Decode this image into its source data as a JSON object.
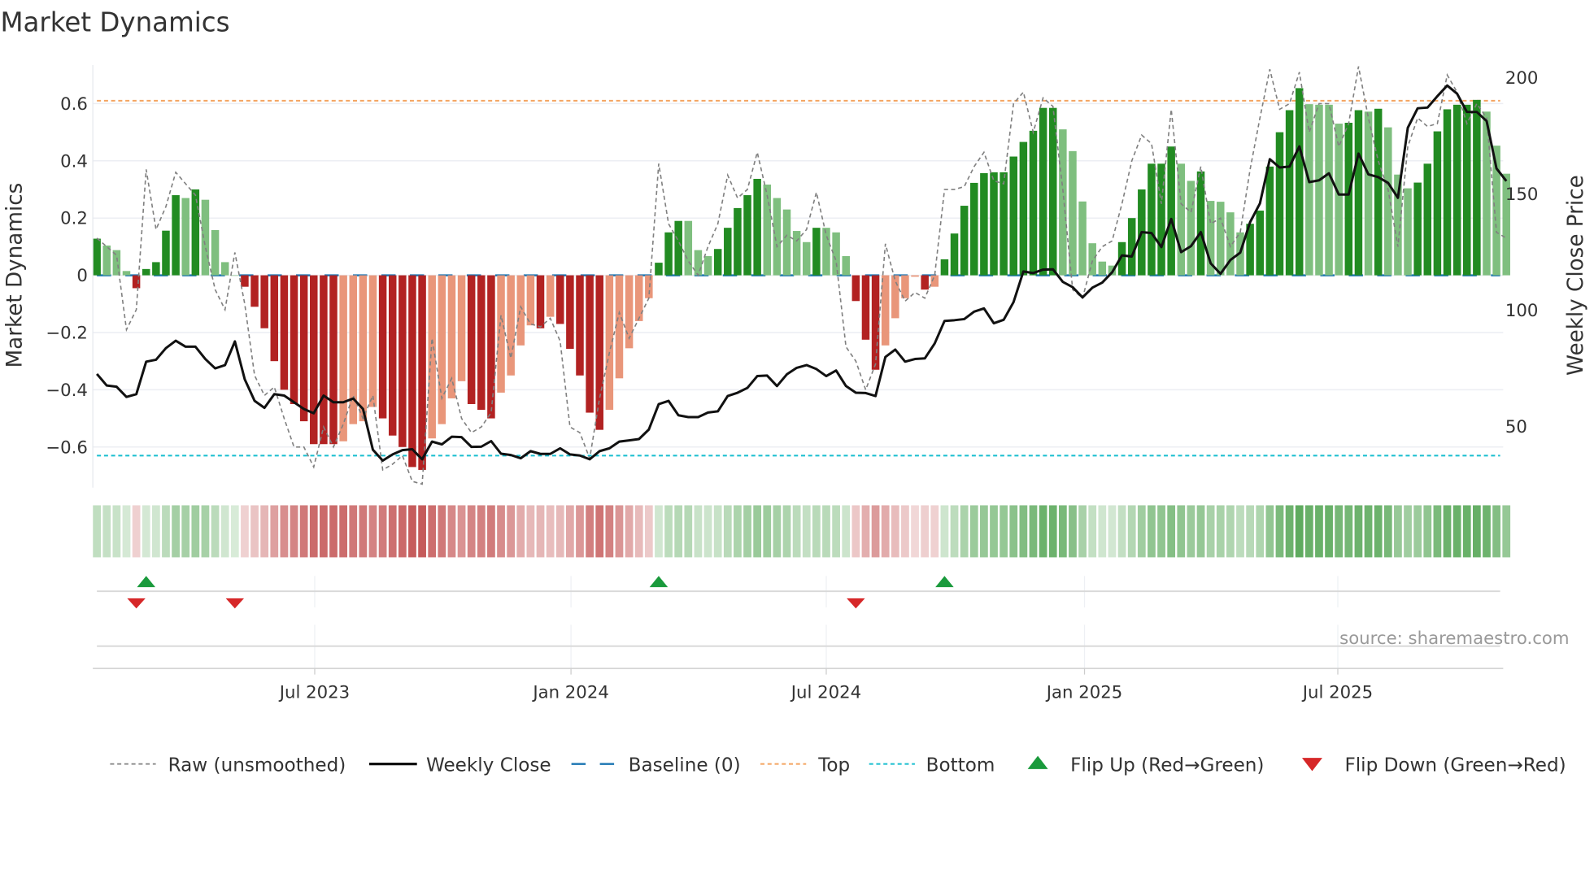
{
  "chart_data": {
    "type": "bar",
    "title": "Market Dynamics",
    "ylabel": "Market Dynamics",
    "y2label": "Weekly Close Price",
    "ylim": [
      -0.74,
      0.74
    ],
    "y2lim": [
      10,
      210
    ],
    "yticks": [
      "0.6",
      "0.4",
      "0.2",
      "0",
      "−0.2",
      "−0.4",
      "−0.6"
    ],
    "ytick_values": [
      0.6,
      0.4,
      0.2,
      0,
      -0.2,
      -0.4,
      -0.6
    ],
    "y2ticks": [
      "200",
      "150",
      "100",
      "50"
    ],
    "y2tick_values": [
      200,
      150,
      100,
      50
    ],
    "frequency": "weekly",
    "xticks": [
      {
        "label": "Jul 2023",
        "week_index": 22.1
      },
      {
        "label": "Jan 2024",
        "week_index": 48.1
      },
      {
        "label": "Jul 2024",
        "week_index": 74.0
      },
      {
        "label": "Jan 2025",
        "week_index": 100.2
      },
      {
        "label": "Jul 2025",
        "week_index": 125.9
      }
    ],
    "top_level": 0.61,
    "bottom_level": -0.63,
    "baseline": 0,
    "grid": true,
    "legend_placement": "bottom",
    "series": [
      {
        "name": "Market Dynamics (smoothed)",
        "values": [
          0.128,
          0.104,
          0.088,
          0.015,
          -0.045,
          0.022,
          0.046,
          0.156,
          0.28,
          0.27,
          0.3,
          0.264,
          0.158,
          0.046,
          0.0,
          -0.04,
          -0.11,
          -0.185,
          -0.3,
          -0.4,
          -0.45,
          -0.51,
          -0.59,
          -0.59,
          -0.59,
          -0.58,
          -0.52,
          -0.51,
          -0.46,
          -0.5,
          -0.56,
          -0.6,
          -0.67,
          -0.68,
          -0.57,
          -0.52,
          -0.43,
          -0.37,
          -0.45,
          -0.47,
          -0.5,
          -0.41,
          -0.35,
          -0.245,
          -0.175,
          -0.185,
          -0.145,
          -0.17,
          -0.257,
          -0.35,
          -0.48,
          -0.54,
          -0.47,
          -0.36,
          -0.255,
          -0.16,
          -0.08,
          0.044,
          0.15,
          0.19,
          0.19,
          0.088,
          0.067,
          0.092,
          0.166,
          0.235,
          0.28,
          0.337,
          0.317,
          0.27,
          0.23,
          0.155,
          0.116,
          0.166,
          0.166,
          0.15,
          0.067,
          -0.09,
          -0.225,
          -0.33,
          -0.245,
          -0.15,
          -0.08,
          -0.005,
          -0.05,
          -0.04,
          0.056,
          0.146,
          0.243,
          0.323,
          0.357,
          0.36,
          0.36,
          0.415,
          0.466,
          0.505,
          0.585,
          0.585,
          0.51,
          0.434,
          0.258,
          0.112,
          0.048,
          0.034,
          0.116,
          0.2,
          0.3,
          0.39,
          0.39,
          0.45,
          0.39,
          0.33,
          0.363,
          0.26,
          0.257,
          0.22,
          0.15,
          0.18,
          0.226,
          0.38,
          0.5,
          0.577,
          0.654,
          0.598,
          0.596,
          0.596,
          0.53,
          0.533,
          0.577,
          0.572,
          0.582,
          0.517,
          0.352,
          0.304,
          0.324,
          0.39,
          0.503,
          0.58,
          0.596,
          0.596,
          0.613,
          0.572,
          0.453,
          0.355
        ],
        "strong": [
          1,
          0,
          0,
          0,
          1,
          1,
          1,
          1,
          1,
          0,
          1,
          0,
          0,
          0,
          0,
          1,
          1,
          1,
          1,
          1,
          1,
          1,
          1,
          1,
          1,
          0,
          0,
          0,
          0,
          1,
          1,
          1,
          1,
          1,
          0,
          0,
          0,
          0,
          1,
          1,
          1,
          0,
          0,
          0,
          0,
          1,
          0,
          1,
          1,
          1,
          1,
          1,
          0,
          0,
          0,
          0,
          0,
          1,
          1,
          1,
          0,
          0,
          0,
          1,
          1,
          1,
          1,
          1,
          0,
          0,
          0,
          0,
          0,
          1,
          0,
          0,
          0,
          1,
          1,
          1,
          0,
          0,
          0,
          0,
          1,
          0,
          1,
          1,
          1,
          1,
          1,
          1,
          1,
          1,
          1,
          1,
          1,
          1,
          0,
          0,
          0,
          0,
          0,
          0,
          1,
          1,
          1,
          1,
          1,
          1,
          0,
          0,
          1,
          0,
          0,
          0,
          0,
          1,
          1,
          1,
          1,
          1,
          1,
          0,
          0,
          0,
          0,
          1,
          1,
          0,
          1,
          0,
          0,
          0,
          1,
          1,
          1,
          1,
          1,
          1,
          1,
          0,
          0,
          0
        ]
      },
      {
        "name": "Raw (unsmoothed)",
        "values": [
          0.13,
          0.1,
          0.07,
          -0.19,
          -0.12,
          0.37,
          0.16,
          0.24,
          0.36,
          0.32,
          0.28,
          0.1,
          -0.05,
          -0.12,
          0.08,
          -0.1,
          -0.35,
          -0.42,
          -0.39,
          -0.5,
          -0.6,
          -0.6,
          -0.67,
          -0.53,
          -0.6,
          -0.52,
          -0.42,
          -0.5,
          -0.42,
          -0.68,
          -0.66,
          -0.63,
          -0.72,
          -0.73,
          -0.22,
          -0.43,
          -0.36,
          -0.5,
          -0.55,
          -0.53,
          -0.48,
          -0.14,
          -0.29,
          -0.11,
          -0.17,
          -0.18,
          -0.15,
          -0.23,
          -0.53,
          -0.55,
          -0.64,
          -0.43,
          -0.27,
          -0.13,
          -0.22,
          -0.15,
          -0.08,
          0.39,
          0.18,
          0.12,
          0.05,
          0.0,
          0.1,
          0.18,
          0.35,
          0.27,
          0.3,
          0.43,
          0.28,
          0.1,
          0.14,
          0.12,
          0.16,
          0.29,
          0.14,
          0.05,
          -0.25,
          -0.3,
          -0.4,
          -0.31,
          0.11,
          -0.02,
          -0.09,
          -0.06,
          -0.08,
          0.0,
          0.3,
          0.3,
          0.31,
          0.38,
          0.43,
          0.33,
          0.32,
          0.6,
          0.64,
          0.5,
          0.62,
          0.59,
          0.3,
          -0.05,
          -0.08,
          0.05,
          0.1,
          0.12,
          0.25,
          0.4,
          0.49,
          0.46,
          0.25,
          0.58,
          0.25,
          0.22,
          0.38,
          0.18,
          0.2,
          0.1,
          0.15,
          0.37,
          0.55,
          0.72,
          0.58,
          0.6,
          0.71,
          0.5,
          0.6,
          0.6,
          0.45,
          0.53,
          0.73,
          0.55,
          0.4,
          0.3,
          0.1,
          0.45,
          0.55,
          0.52,
          0.53,
          0.7,
          0.64,
          0.53,
          0.6,
          0.55,
          0.15,
          0.13
        ]
      },
      {
        "name": "Weekly Close",
        "axis": "right",
        "values": [
          72.6,
          67.6,
          67.1,
          62.7,
          63.9,
          77.9,
          78.7,
          83.7,
          86.9,
          84.3,
          84.3,
          79.0,
          75.0,
          76.4,
          86.6,
          70.3,
          61.0,
          58.0,
          63.9,
          63.3,
          60.4,
          57.5,
          55.7,
          63.3,
          60.4,
          60.4,
          62.0,
          57.5,
          40.0,
          35.3,
          38.0,
          39.8,
          40.2,
          35.9,
          43.5,
          42.3,
          45.6,
          45.4,
          41.2,
          41.3,
          43.7,
          38.3,
          37.7,
          36.3,
          39.4,
          38.2,
          38.2,
          40.6,
          38.0,
          37.5,
          35.9,
          39.4,
          40.6,
          43.5,
          44.0,
          44.6,
          48.7,
          59.6,
          61.0,
          54.8,
          54.0,
          54.0,
          56.0,
          56.5,
          63.1,
          64.5,
          66.6,
          71.7,
          71.9,
          67.4,
          72.4,
          75.2,
          76.4,
          74.7,
          71.7,
          74.1,
          67.4,
          64.5,
          64.4,
          63.1,
          79.9,
          83.1,
          77.9,
          79.0,
          79.3,
          85.7,
          95.4,
          95.7,
          96.2,
          99.4,
          100.8,
          94.4,
          95.9,
          103.5,
          116.7,
          116.0,
          117.5,
          117.6,
          112.2,
          109.9,
          105.5,
          109.7,
          111.9,
          116.3,
          123.6,
          123.1,
          133.6,
          133.2,
          127.2,
          139.3,
          125.0,
          127.6,
          133.6,
          120.2,
          115.7,
          121.6,
          124.8,
          137.9,
          146.0,
          165.0,
          161.4,
          161.8,
          170.5,
          155.1,
          155.9,
          158.9,
          149.8,
          149.8,
          167.4,
          158.5,
          157.3,
          154.8,
          148.4,
          178.5,
          186.9,
          187.2,
          192.1,
          196.7,
          193.2,
          185.3,
          185.3,
          181.4,
          161.0,
          155.6
        ]
      }
    ],
    "flips": [
      {
        "type": "up",
        "week_index": 5
      },
      {
        "type": "up",
        "week_index": 57
      },
      {
        "type": "up",
        "week_index": 86
      },
      {
        "type": "down",
        "week_index": 4
      },
      {
        "type": "down",
        "week_index": 14
      },
      {
        "type": "down",
        "week_index": 77
      }
    ],
    "legend": [
      {
        "label": "Raw (unsmoothed)",
        "kind": "raw"
      },
      {
        "label": "Weekly Close",
        "kind": "close"
      },
      {
        "label": "Baseline (0)",
        "kind": "baseline"
      },
      {
        "label": "Top",
        "kind": "top"
      },
      {
        "label": "Bottom",
        "kind": "bottom"
      },
      {
        "label": "Flip Up (Red→Green)",
        "kind": "up"
      },
      {
        "label": "Flip Down (Green→Red)",
        "kind": "down"
      }
    ],
    "source": "source: sharemaestro.com"
  },
  "colors": {
    "strong_green": "#228b22",
    "weak_green": "#7fbf7f",
    "strong_red": "#b22222",
    "weak_red": "#e9967a",
    "top": "#f4a460",
    "bottom": "#17becf",
    "baseline": "#1f77b4",
    "raw": "#808080",
    "close": "#111111",
    "flip_up": "#1a9a3c",
    "flip_down": "#d62728"
  }
}
